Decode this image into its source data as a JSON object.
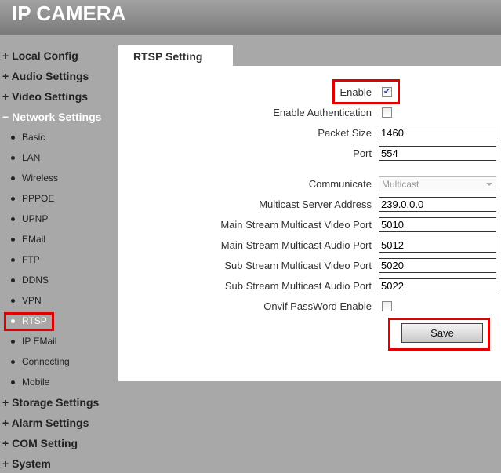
{
  "header": {
    "title": "IP CAMERA"
  },
  "nav": {
    "top_before": [
      {
        "label": "Local Config",
        "sign": "+"
      },
      {
        "label": "Audio Settings",
        "sign": "+"
      },
      {
        "label": "Video Settings",
        "sign": "+"
      },
      {
        "label": "Network Settings",
        "sign": "−"
      }
    ],
    "sub": [
      "Basic",
      "LAN",
      "Wireless",
      "PPPOE",
      "UPNP",
      "EMail",
      "FTP",
      "DDNS",
      "VPN",
      "RTSP",
      "IP EMail",
      "Connecting",
      "Mobile"
    ],
    "active_sub": "RTSP",
    "top_after": [
      {
        "label": "Storage Settings",
        "sign": "+"
      },
      {
        "label": "Alarm Settings",
        "sign": "+"
      },
      {
        "label": "COM Setting",
        "sign": "+"
      },
      {
        "label": "System",
        "sign": "+"
      }
    ]
  },
  "tab": {
    "label": "RTSP Setting"
  },
  "form": {
    "enable": {
      "label": "Enable",
      "checked": true
    },
    "auth": {
      "label": "Enable Authentication",
      "checked": false
    },
    "packet_size": {
      "label": "Packet Size",
      "value": "1460"
    },
    "port": {
      "label": "Port",
      "value": "554"
    },
    "communicate": {
      "label": "Communicate",
      "value": "Multicast"
    },
    "multicast_server": {
      "label": "Multicast Server Address",
      "value": "239.0.0.0"
    },
    "main_video": {
      "label": "Main Stream Multicast Video Port",
      "value": "5010"
    },
    "main_audio": {
      "label": "Main Stream Multicast Audio Port",
      "value": "5012"
    },
    "sub_video": {
      "label": "Sub Stream Multicast Video Port",
      "value": "5020"
    },
    "sub_audio": {
      "label": "Sub Stream Multicast Audio Port",
      "value": "5022"
    },
    "onvif": {
      "label": "Onvif PassWord Enable",
      "checked": false
    },
    "save_label": "Save"
  },
  "colors": {
    "highlight": "#e00000",
    "background": "#a8a8a8"
  }
}
